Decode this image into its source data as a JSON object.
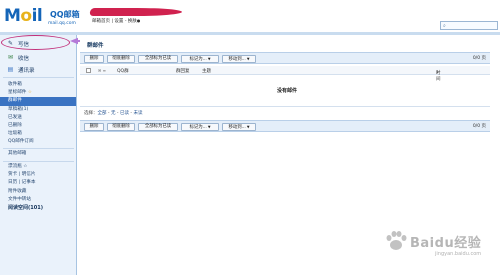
{
  "logo": {
    "mail": "Mail",
    "cn": "QQ邮箱",
    "domain": "mail.qq.com"
  },
  "header": {
    "links": [
      "邮箱首页",
      "设置",
      "换肤"
    ],
    "separator": " | ",
    "redacted_color": "#d0224f",
    "search_placeholder": "",
    "search_icon": "magnifier-icon"
  },
  "sidebar": {
    "write": "写信",
    "inbox": "收信",
    "contacts": "通讯录",
    "highlight_color": "#c2307a",
    "folders": [
      {
        "label": "收件箱",
        "active": false
      },
      {
        "label": "星标邮件",
        "star": "☆",
        "active": false
      },
      {
        "label": "群邮件",
        "active": true
      },
      {
        "label": "草稿箱(1)",
        "active": false
      },
      {
        "label": "已发送",
        "active": false
      },
      {
        "label": "已删除",
        "active": false
      },
      {
        "label": "垃圾箱",
        "active": false
      },
      {
        "label": "QQ邮件订阅",
        "active": false
      }
    ],
    "other_mailbox": "其他邮箱",
    "tools": [
      "漂流瓶 ☆",
      "贺卡 | 明信片",
      "日历 | 记事本",
      "附件收藏",
      "文件中转站"
    ],
    "reading_space": "阅读空间(101)"
  },
  "main": {
    "title": "群邮件",
    "toolbar": {
      "delete": "删除",
      "perm_delete": "彻底删除",
      "mark_all_read": "全部标为已读",
      "mark_as": "标记为...",
      "move_to": "移动到...",
      "pager": "0/0 页"
    },
    "columns": [
      "QQ群",
      "群回复",
      "主题",
      "时间"
    ],
    "empty_message": "没有邮件",
    "select": {
      "label": "选择：",
      "options": [
        "全部",
        "无",
        "已读",
        "未读"
      ],
      "sep": " - "
    }
  },
  "watermark": {
    "brand": "Baidu经验",
    "sub": "jingyan.baidu.com"
  }
}
